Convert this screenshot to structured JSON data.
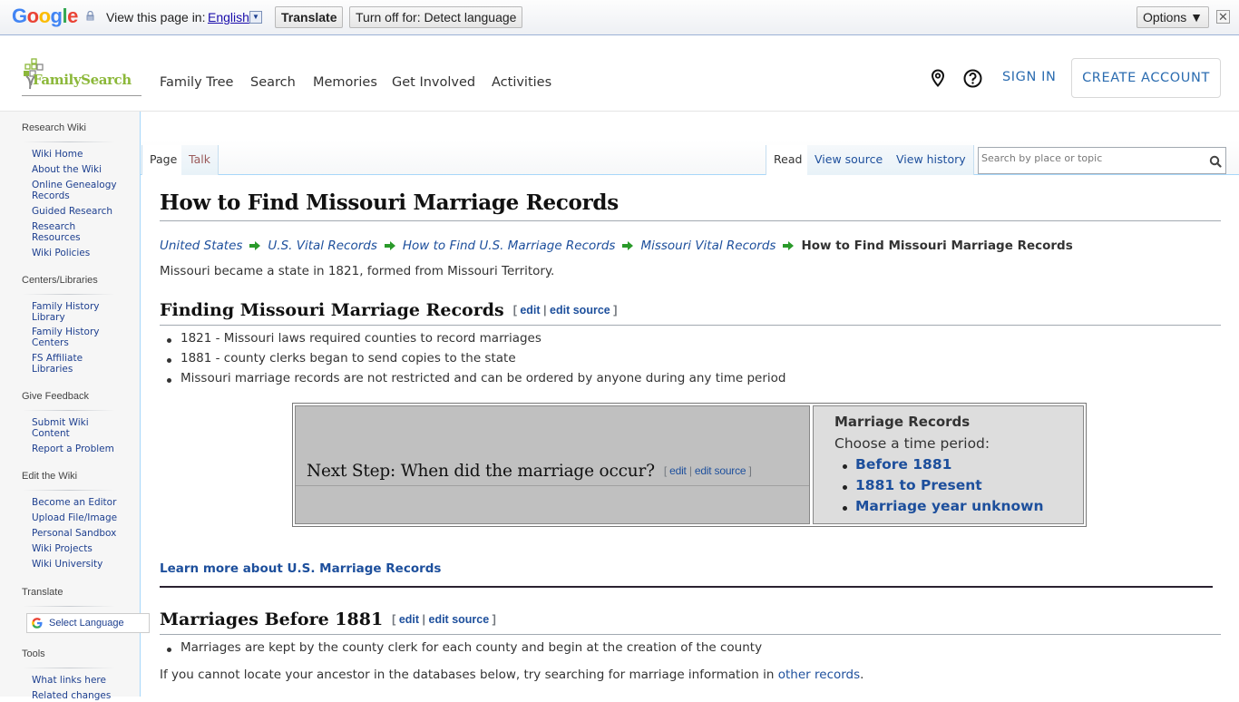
{
  "translate_bar": {
    "logo": [
      "G",
      "o",
      "o",
      "g",
      "l",
      "e"
    ],
    "view_label": "View this page in:",
    "language": "English",
    "translate_btn": "Translate",
    "turn_off_btn": "Turn off for: Detect language",
    "options_btn": "Options ▼",
    "close_icon": "✕"
  },
  "header": {
    "logo_text": "FamilySearch",
    "nav": [
      "Family Tree",
      "Search",
      "Memories",
      "Get Involved",
      "Activities"
    ],
    "sign_in": "SIGN IN",
    "create_account": "CREATE ACCOUNT"
  },
  "sidebar": {
    "sections": [
      {
        "heading": "Research Wiki",
        "items": [
          "Wiki Home",
          "About the Wiki",
          "Online Genealogy Records",
          "Guided Research",
          "Research Resources",
          "Wiki Policies"
        ]
      },
      {
        "heading": "Centers/Libraries",
        "items": [
          "Family History Library",
          "Family History Centers",
          "FS Affiliate Libraries"
        ]
      },
      {
        "heading": "Give Feedback",
        "items": [
          "Submit Wiki Content",
          "Report a Problem"
        ]
      },
      {
        "heading": "Edit the Wiki",
        "items": [
          "Become an Editor",
          "Upload File/Image",
          "Personal Sandbox",
          "Wiki Projects",
          "Wiki University"
        ]
      },
      {
        "heading": "Translate",
        "items": []
      },
      {
        "heading": "Tools",
        "items": [
          "What links here",
          "Related changes"
        ]
      }
    ],
    "select_language": "Select Language"
  },
  "tabs": {
    "page": "Page",
    "talk": "Talk",
    "read": "Read",
    "view_source": "View source",
    "view_history": "View history",
    "search_placeholder": "Search by place or topic"
  },
  "article": {
    "title": "How to Find Missouri Marriage Records",
    "breadcrumbs": [
      "United States",
      "U.S. Vital Records",
      "How to Find U.S. Marriage Records",
      "Missouri Vital Records"
    ],
    "breadcrumb_current": "How to Find Missouri Marriage Records",
    "intro": "Missouri became a state in 1821, formed from Missouri Territory.",
    "edit": "edit",
    "edit_source": "edit source",
    "section1": {
      "heading": "Finding Missouri Marriage Records",
      "bullets": [
        "1821 - Missouri laws required counties to record marriages",
        "1881 - county clerks began to send copies to the state",
        "Missouri marriage records are not restricted and can be ordered by anyone during any time period"
      ]
    },
    "next_step": {
      "question": "Next Step: When did the marriage occur?",
      "box_title": "Marriage Records",
      "box_subtitle": "Choose a time period:",
      "links": [
        "Before 1881",
        "1881 to Present",
        "Marriage year unknown"
      ]
    },
    "learn_more": "Learn more about U.S. Marriage Records",
    "section2": {
      "heading": "Marriages Before 1881",
      "bullets": [
        "Marriages are kept by the county clerk for each county and begin at the creation of the county"
      ],
      "para_before": "If you cannot locate your ancestor in the databases below, try searching for marriage information in ",
      "para_link": "other records",
      "para_after": "."
    }
  },
  "colors": {
    "link": "#1d4f9c",
    "brand_green": "#8cb83a",
    "arrow_green": "#2a9a2a",
    "fs_blue": "#2b6cb0"
  }
}
